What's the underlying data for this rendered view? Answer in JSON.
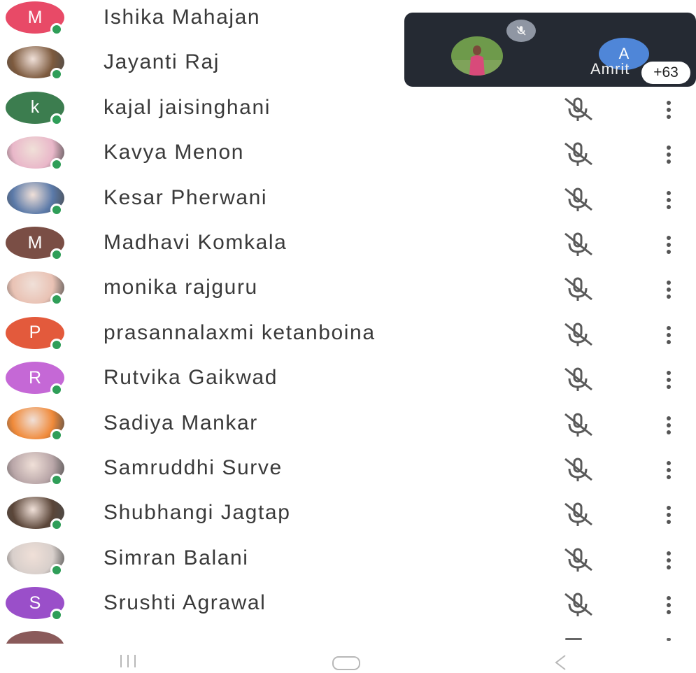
{
  "participants": [
    {
      "name": "Ishika Mahajan",
      "initial": "M",
      "color": "#e84a67",
      "avatar": "initial"
    },
    {
      "name": "Jayanti Raj",
      "initial": "",
      "color": "#7d5a3e",
      "avatar": "photo"
    },
    {
      "name": "kajal jaisinghani",
      "initial": "k",
      "color": "#3c7d4f",
      "avatar": "initial"
    },
    {
      "name": "Kavya Menon",
      "initial": "",
      "color": "#e9b7c9",
      "avatar": "photo"
    },
    {
      "name": "Kesar Pherwani",
      "initial": "",
      "color": "#5a79a8",
      "avatar": "photo"
    },
    {
      "name": "Madhavi Komkala",
      "initial": "M",
      "color": "#7a4e45",
      "avatar": "initial"
    },
    {
      "name": "monika rajguru",
      "initial": "",
      "color": "#e9c2b4",
      "avatar": "photo"
    },
    {
      "name": "prasannalaxmi ketanboina",
      "initial": "P",
      "color": "#e35a3c",
      "avatar": "initial"
    },
    {
      "name": "Rutvika Gaikwad",
      "initial": "R",
      "color": "#c568d6",
      "avatar": "initial"
    },
    {
      "name": "Sadiya Mankar",
      "initial": "",
      "color": "#f08a3a",
      "avatar": "photo"
    },
    {
      "name": "Samruddhi Surve",
      "initial": "",
      "color": "#b9a6a8",
      "avatar": "photo"
    },
    {
      "name": "Shubhangi Jagtap",
      "initial": "",
      "color": "#5a4538",
      "avatar": "photo"
    },
    {
      "name": "Simran Balani",
      "initial": "",
      "color": "#d8cfcb",
      "avatar": "photo"
    },
    {
      "name": "Srushti Agrawal",
      "initial": "S",
      "color": "#9a4fc9",
      "avatar": "initial"
    }
  ],
  "overlay": {
    "participant_initial": "A",
    "participant_name": "Amrit",
    "extra_count": "+63"
  },
  "colors": {
    "online_dot": "#2f9e58",
    "overlay_bg": "#252a33",
    "icon_gray": "#5a5a5a"
  }
}
